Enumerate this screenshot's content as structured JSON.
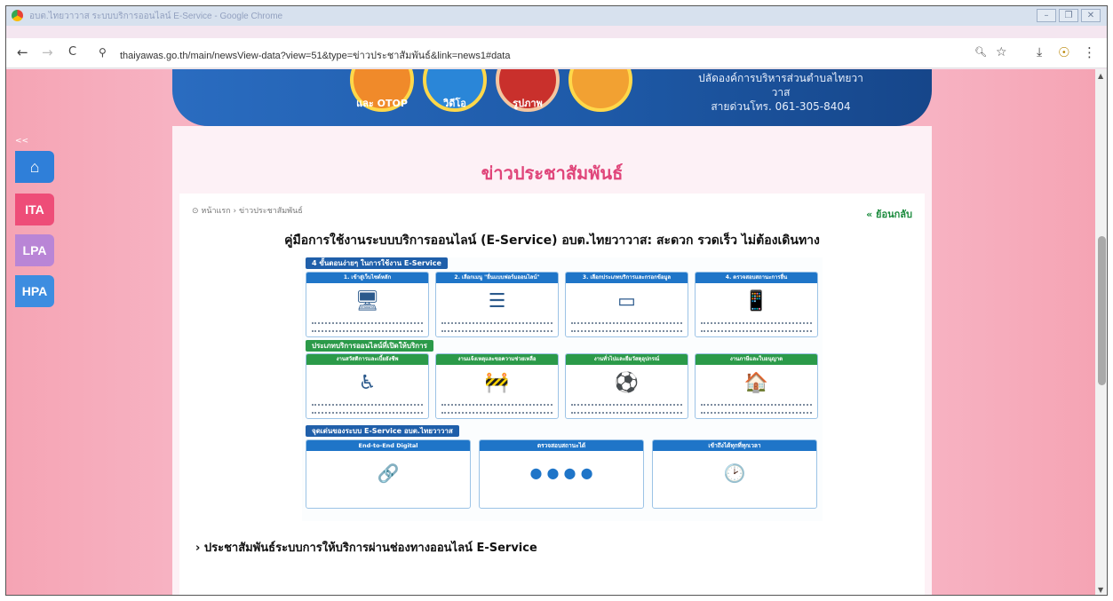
{
  "window": {
    "title": "อบต.ไทยวาวาส ระบบบริการออนไลน์ E-Service - Google Chrome",
    "controls": [
      "–",
      "❐",
      "✕"
    ]
  },
  "toolbar": {
    "back_icon": "←",
    "forward_icon": "→",
    "reload_icon": "C",
    "site_info_icon": "⚲",
    "url": "thaiyawas.go.th/main/newsView-data?view=51&type=ข่าวประชาสัมพันธ์&link=news1#data",
    "zoom_icon": "🔍︎",
    "bookmark_icon": "☆",
    "download_icon": "⤓",
    "profile_icon": "☉",
    "menu_icon": "⋮"
  },
  "banner": {
    "badges": [
      "และ OTOP",
      "วิดีโอ",
      "รูปภาพ"
    ],
    "office_line": "ปลัดองค์การบริหารส่วนตำบลไทยวาวาส",
    "hotline": "สายด่วนโทร. 061-305-8404"
  },
  "sidebar": {
    "collapse_label": "<<",
    "home_icon": "home-icon",
    "items": [
      {
        "label": "ITA",
        "color": "#ee4d78"
      },
      {
        "label": "LPA",
        "color": "#b985d6"
      },
      {
        "label": "HPA",
        "color": "#3d8de0"
      }
    ]
  },
  "page": {
    "section_title": "ข่าวประชาสัมพันธ์",
    "breadcrumb": "⊙ หน้าแรก  ›  ข่าวประชาสัมพันธ์",
    "back_link": "« ย้อนกลับ",
    "article_title": "คู่มือการใช้งานระบบบริการออนไลน์ (E-Service) อบต.ไทยวาวาส: สะดวก รวดเร็ว ไม่ต้องเดินทาง",
    "sub_link": "› ประชาสัมพันธ์ระบบการให้บริการผ่านช่องทางออนไลน์ E-Service"
  },
  "infographic": {
    "steps_heading": "4 ขั้นตอนง่ายๆ ในการใช้งาน E-Service",
    "steps": [
      {
        "title": "1. เข้าสู่เว็บไซต์หลัก",
        "icon": "🖥"
      },
      {
        "title": "2. เลือกเมนู \"ยื่นแบบฟอร์มออนไลน์\"",
        "icon": "☰"
      },
      {
        "title": "3. เลือกประเภทบริการและกรอกข้อมูล",
        "icon": "▭"
      },
      {
        "title": "4. ตรวจสอบสถานะการยื่น",
        "icon": "📱"
      }
    ],
    "services_heading": "ประเภทบริการออนไลน์ที่เปิดให้บริการ",
    "services": [
      {
        "title": "งานสวัสดิการและเบี้ยยังชีพ",
        "icon": "♿"
      },
      {
        "title": "งานแจ้งเหตุและขอความช่วยเหลือ",
        "icon": "🚧"
      },
      {
        "title": "งานทั่วไปและยืมวัสดุอุปกรณ์",
        "icon": "⚽"
      },
      {
        "title": "งานภาษีและใบอนุญาต",
        "icon": "🏠"
      }
    ],
    "benefits_heading": "จุดเด่นของระบบ E-Service อบต.ไทยวาวาส",
    "benefits": [
      {
        "title": "End-to-End Digital",
        "icon": "🔗"
      },
      {
        "title": "ตรวจสอบสถานะได้",
        "icon": "● ● ● ●"
      },
      {
        "title": "เข้าถึงได้ทุกที่ทุกเวลา",
        "icon": "🕑"
      }
    ]
  }
}
